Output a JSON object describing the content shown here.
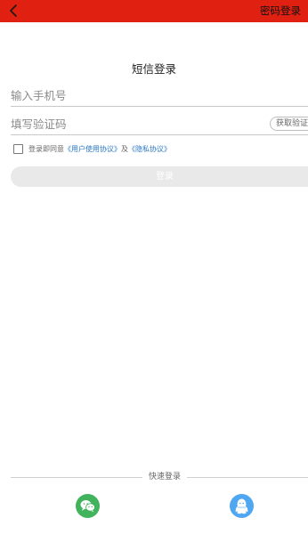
{
  "header": {
    "back_icon": "chevron-left-icon",
    "password_login_label": "密码登录",
    "bar_color": "#e02010"
  },
  "page": {
    "title": "短信登录"
  },
  "form": {
    "phone_placeholder": "输入手机号",
    "code_placeholder": "填写验证码",
    "get_code_label": "获取验证码",
    "agree_prefix": "登录即同意",
    "user_agreement": "《用户使用协议》",
    "conjunction": "及",
    "privacy_policy": "《隐私协议》",
    "agreed": false,
    "login_label": "登录"
  },
  "quick_login": {
    "label": "快速登录",
    "options": [
      {
        "name": "wechat",
        "icon": "wechat-icon",
        "color": "#41b35d"
      },
      {
        "name": "qq",
        "icon": "qq-icon",
        "color": "#4ea7f0"
      }
    ]
  },
  "colors": {
    "link": "#2a78c6",
    "disabled_button": "#e9e9e9"
  }
}
